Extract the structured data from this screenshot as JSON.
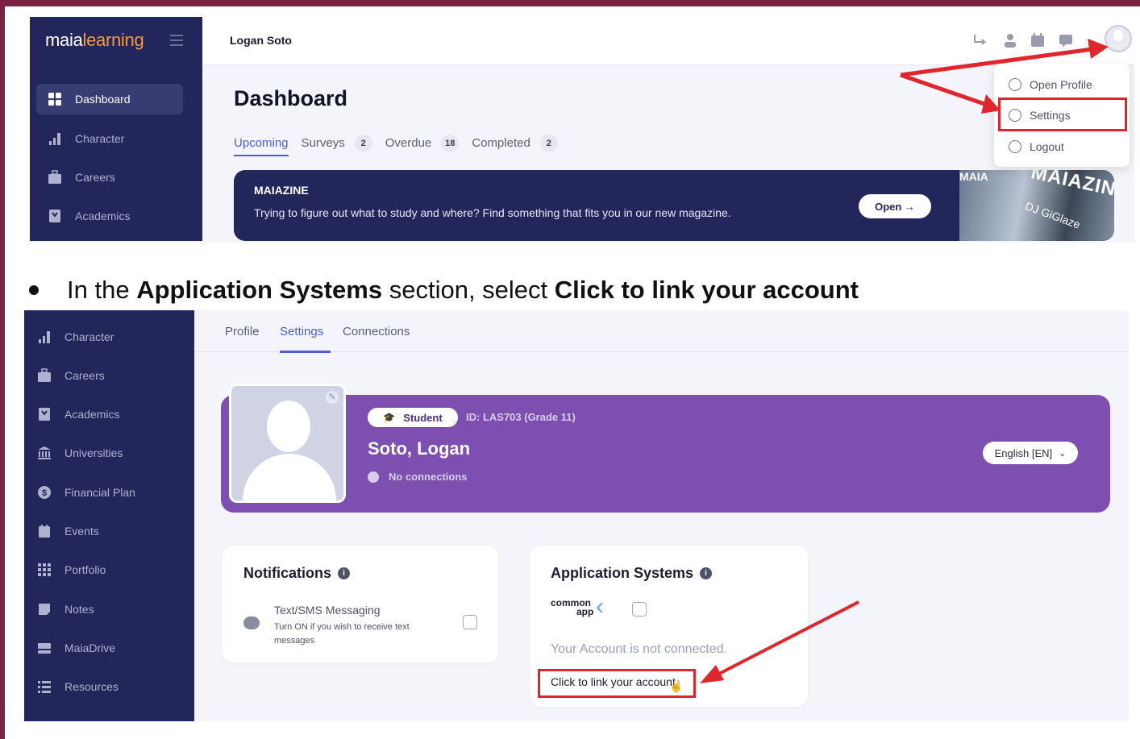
{
  "top": {
    "logo": {
      "part1": "maia",
      "part2": "learning"
    },
    "user_name": "Logan Soto",
    "sidebar": [
      {
        "label": "Dashboard",
        "icon": "grid-icon",
        "active": true
      },
      {
        "label": "Character",
        "icon": "bar-chart-icon"
      },
      {
        "label": "Careers",
        "icon": "briefcase-icon"
      },
      {
        "label": "Academics",
        "icon": "book-icon"
      }
    ],
    "page_title": "Dashboard",
    "tabs": [
      {
        "label": "Upcoming",
        "badge": ""
      },
      {
        "label": "Surveys",
        "badge": "2"
      },
      {
        "label": "Overdue",
        "badge": "18"
      },
      {
        "label": "Completed",
        "badge": "2"
      }
    ],
    "banner": {
      "title": "MAIAZINE",
      "text": "Trying to figure out what to study and where? Find something that fits you in our new magazine.",
      "button": "Open →",
      "mag_small": "MAIA",
      "mag_title": "MAIAZIN",
      "mag_sub": "DJ GiGlaze"
    },
    "dropdown": [
      {
        "label": "Open Profile",
        "icon": "profile-icon"
      },
      {
        "label": "Settings",
        "icon": "gear-icon"
      },
      {
        "label": "Logout",
        "icon": "logout-icon"
      }
    ]
  },
  "instruction": {
    "p1": "In the ",
    "b1": "Application Systems",
    "p2": " section, select ",
    "b2": "Click to link your account"
  },
  "bottom": {
    "sidebar": [
      {
        "label": "Character",
        "icon": "bar-chart-icon"
      },
      {
        "label": "Careers",
        "icon": "briefcase-icon"
      },
      {
        "label": "Academics",
        "icon": "book-icon"
      },
      {
        "label": "Universities",
        "icon": "university-icon"
      },
      {
        "label": "Financial Plan",
        "icon": "dollar-icon"
      },
      {
        "label": "Events",
        "icon": "calendar-icon"
      },
      {
        "label": "Portfolio",
        "icon": "grid-icon"
      },
      {
        "label": "Notes",
        "icon": "note-icon"
      },
      {
        "label": "MaiaDrive",
        "icon": "drive-icon"
      },
      {
        "label": "Resources",
        "icon": "list-icon"
      }
    ],
    "tabs": [
      "Profile",
      "Settings",
      "Connections"
    ],
    "profile": {
      "role": "Student",
      "id": "ID: LAS703 (Grade 11)",
      "name": "Soto, Logan",
      "connections": "No connections",
      "language": "English [EN]"
    },
    "notifications": {
      "title": "Notifications",
      "sms_title": "Text/SMS Messaging",
      "sms_desc": "Turn ON if you wish to receive text messages"
    },
    "app_systems": {
      "title": "Application Systems",
      "commonapp_line1": "common",
      "commonapp_line2": "app",
      "status": "Your Account is not connected.",
      "link": "Click to link your account"
    }
  },
  "colors": {
    "sidebar": "#22265a",
    "accent": "#4d5bdc",
    "profile_band": "#7c4fb0",
    "annotation": "#e0262a"
  }
}
